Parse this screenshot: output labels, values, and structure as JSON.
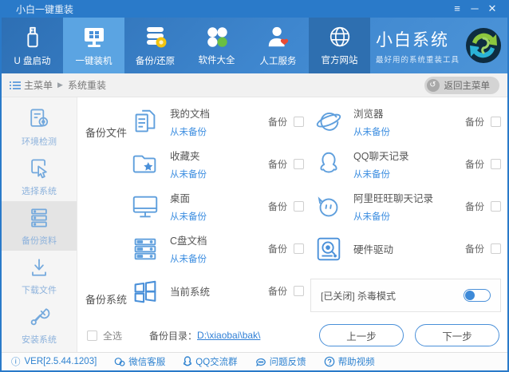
{
  "window": {
    "title": "小白一键重装",
    "controls": {
      "menu": "≡",
      "minimize": "─",
      "close": "✕"
    }
  },
  "nav": {
    "items": [
      {
        "label": "U 盘启动"
      },
      {
        "label": "一键装机"
      },
      {
        "label": "备份/还原"
      },
      {
        "label": "软件大全"
      },
      {
        "label": "人工服务"
      },
      {
        "label": "官方网站"
      }
    ],
    "brand": {
      "title": "小白系统",
      "subtitle": "最好用的系统重装工具"
    }
  },
  "breadcrumb": {
    "root": "主菜单",
    "sep": "▶",
    "current": "系统重装",
    "back_icon": "↺",
    "back_label": "返回主菜单"
  },
  "sidebar": {
    "items": [
      {
        "label": "环境检测"
      },
      {
        "label": "选择系统"
      },
      {
        "label": "备份资料"
      },
      {
        "label": "下载文件"
      },
      {
        "label": "安装系统"
      }
    ]
  },
  "main": {
    "files_section_label": "备份文件",
    "system_section_label": "备份系统",
    "backup_label": "备份",
    "rows_left": [
      {
        "name": "我的文档",
        "status": "从未备份"
      },
      {
        "name": "收藏夹",
        "status": "从未备份"
      },
      {
        "name": "桌面",
        "status": "从未备份"
      },
      {
        "name": "C盘文档",
        "status": "从未备份"
      },
      {
        "name": "当前系统",
        "status": ""
      }
    ],
    "rows_right": [
      {
        "name": "浏览器",
        "status": "从未备份"
      },
      {
        "name": "QQ聊天记录",
        "status": "从未备份"
      },
      {
        "name": "阿里旺旺聊天记录",
        "status": "从未备份"
      },
      {
        "name": "硬件驱动",
        "status": ""
      }
    ],
    "antivirus": {
      "label": "[已关闭] 杀毒模式",
      "state": "off"
    },
    "select_all_label": "全选",
    "backup_dir_label": "备份目录：",
    "backup_dir_value": "D:\\xiaobai\\bak\\",
    "prev_button": "上一步",
    "next_button": "下一步"
  },
  "statusbar": {
    "info_icon": "ⓘ",
    "version": "VER[2.5.44.1203]",
    "links": [
      {
        "label": "微信客服"
      },
      {
        "label": "QQ交流群"
      },
      {
        "label": "问题反馈"
      },
      {
        "label": "帮助视频"
      }
    ]
  },
  "colors": {
    "accent": "#2e82d0",
    "titlebar": "#2a7ac9",
    "nav_selected": "#5ba4e2",
    "link": "#3b8de0",
    "green": "#69bf43",
    "coin": "#f3c40f"
  }
}
